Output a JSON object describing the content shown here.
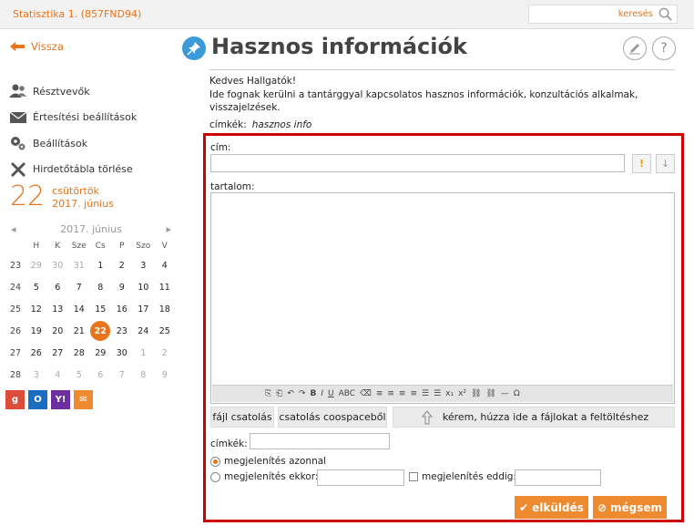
{
  "header": {
    "app_title": "Statisztika 1. (857FND94)",
    "search_placeholder": "keresés"
  },
  "sidebar": {
    "back_label": "Vissza",
    "items": [
      {
        "label": "Résztvevők",
        "icon": "users-icon"
      },
      {
        "label": "Értesítési beállítások",
        "icon": "envelope-icon"
      },
      {
        "label": "Beállítások",
        "icon": "gears-icon"
      },
      {
        "label": "Hirdetőtábla törlése",
        "icon": "x-icon"
      }
    ],
    "date": {
      "day": "22",
      "weekday": "csütörtök",
      "month": "2017. június"
    }
  },
  "calendar": {
    "title": "2017. június",
    "weekdays": [
      "H",
      "K",
      "Sze",
      "Cs",
      "P",
      "Szo",
      "V"
    ],
    "weeks": [
      {
        "wk": "23",
        "days": [
          "29",
          "30",
          "31",
          "1",
          "2",
          "3",
          "4"
        ]
      },
      {
        "wk": "24",
        "days": [
          "5",
          "6",
          "7",
          "8",
          "9",
          "10",
          "11"
        ]
      },
      {
        "wk": "25",
        "days": [
          "12",
          "13",
          "14",
          "15",
          "16",
          "17",
          "18"
        ]
      },
      {
        "wk": "26",
        "days": [
          "19",
          "20",
          "21",
          "22",
          "23",
          "24",
          "25"
        ]
      },
      {
        "wk": "27",
        "days": [
          "26",
          "27",
          "28",
          "29",
          "30",
          "1",
          "2"
        ]
      },
      {
        "wk": "28",
        "days": [
          "3",
          "4",
          "5",
          "6",
          "7",
          "8",
          "9"
        ]
      }
    ],
    "today": "22",
    "exports": [
      {
        "icon": "google-icon",
        "color": "#dd4b39",
        "glyph": "g"
      },
      {
        "icon": "outlook-icon",
        "color": "#1a6dc0",
        "glyph": "O"
      },
      {
        "icon": "yahoo-icon",
        "color": "#6b2fa0",
        "glyph": "Y!"
      },
      {
        "icon": "mail-icon",
        "color": "#ee8a2f",
        "glyph": "✉"
      }
    ]
  },
  "page": {
    "title": "Hasznos információk",
    "intro_line1": "Kedves Hallgatók!",
    "intro_line2": "Ide fognak kerülni a tantárggyal kapcsolatos hasznos információk, konzultációs alkalmak, visszajelzések.",
    "tags_label": "címkék:",
    "tags_value": "hasznos info"
  },
  "form": {
    "title_label": "cím:",
    "content_label": "tartalom:",
    "attach_label": "fájl csatolás",
    "coospace_label": "csatolás coospaceből",
    "drop_label": "kérem, húzza ide a fájlokat a feltöltéshez",
    "tags_label": "címkék:",
    "opt_now": "megjelenítés azonnal",
    "opt_when": "megjelenítés ekkor:",
    "opt_until": "megjelenítés eddig:",
    "submit_label": "elküldés",
    "cancel_label": "mégsem"
  },
  "toolbar": {
    "items": [
      "⎘",
      "⎗",
      "↶",
      "↷",
      "B",
      "I",
      "U",
      "ABC",
      "⌫",
      "≡",
      "≡",
      "≡",
      "≡",
      "☰",
      "☰",
      "x₁",
      "x²",
      "⛓",
      "⛓",
      "—",
      "Ω"
    ]
  },
  "colors": {
    "accent": "#e8741c",
    "frame": "#d00000",
    "blue": "#3a9bd8"
  }
}
